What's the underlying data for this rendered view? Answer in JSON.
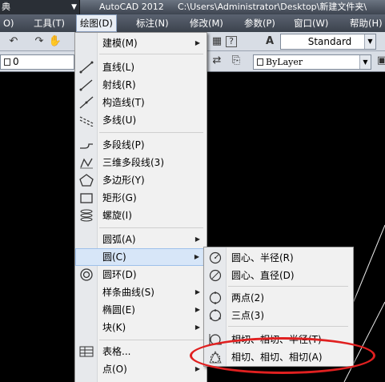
{
  "title_bar": {
    "workspace": "典",
    "app_name": "AutoCAD 2012",
    "file_path": "C:\\Users\\Administrator\\Desktop\\新建文件夹\\"
  },
  "menubar": {
    "items": [
      "O)",
      "工具(T)",
      "绘图(D)",
      "标注(N)",
      "修改(M)",
      "参数(P)",
      "窗口(W)",
      "帮助(H)"
    ],
    "active_index": 2
  },
  "toolbar": {
    "text_style": "Standard",
    "layer_value": "0",
    "color_value": "ByLayer"
  },
  "draw_menu": {
    "items": [
      {
        "label": "建模(M)",
        "submenu": true,
        "icon": "none"
      },
      {
        "label": "直线(L)",
        "icon": "line-icon"
      },
      {
        "label": "射线(R)",
        "icon": "ray-icon"
      },
      {
        "label": "构造线(T)",
        "icon": "xline-icon"
      },
      {
        "label": "多线(U)",
        "icon": "multiline-icon"
      },
      {
        "label": "多段线(P)",
        "icon": "polyline-icon"
      },
      {
        "label": "三维多段线(3)",
        "icon": "3d-polyline-icon"
      },
      {
        "label": "多边形(Y)",
        "icon": "polygon-icon"
      },
      {
        "label": "矩形(G)",
        "icon": "rectangle-icon"
      },
      {
        "label": "螺旋(I)",
        "icon": "helix-icon"
      },
      {
        "label": "圆弧(A)",
        "submenu": true,
        "icon": "none"
      },
      {
        "label": "圆(C)",
        "submenu": true,
        "icon": "none"
      },
      {
        "label": "圆环(D)",
        "icon": "donut-icon"
      },
      {
        "label": "样条曲线(S)",
        "submenu": true,
        "icon": "none"
      },
      {
        "label": "椭圆(E)",
        "submenu": true,
        "icon": "none"
      },
      {
        "label": "块(K)",
        "submenu": true,
        "icon": "none"
      },
      {
        "label": "表格...",
        "icon": "table-icon"
      },
      {
        "label": "点(O)",
        "submenu": true,
        "icon": "none"
      }
    ],
    "highlighted_index": 11
  },
  "circle_menu": {
    "items": [
      {
        "label": "圆心、半径(R)",
        "icon": "circle-center-radius-icon"
      },
      {
        "label": "圆心、直径(D)",
        "icon": "circle-center-diameter-icon"
      },
      {
        "label": "两点(2)",
        "icon": "circle-2point-icon"
      },
      {
        "label": "三点(3)",
        "icon": "circle-3point-icon"
      },
      {
        "label": "相切、相切、半径(T)",
        "icon": "circle-ttr-icon"
      },
      {
        "label": "相切、相切、相切(A)",
        "icon": "circle-ttt-icon"
      }
    ]
  }
}
